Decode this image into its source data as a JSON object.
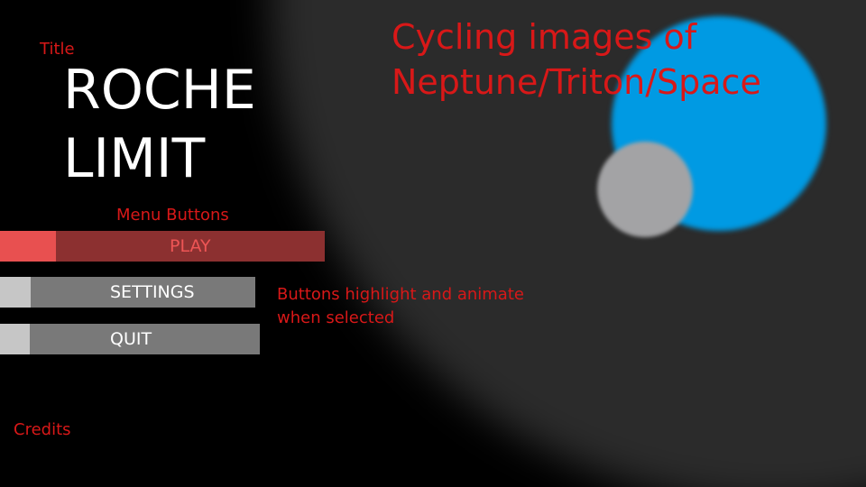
{
  "game_title": {
    "line1": "ROCHE",
    "line2": "LIMIT"
  },
  "menu": {
    "buttons": [
      {
        "label": "PLAY",
        "state": "selected"
      },
      {
        "label": "SETTINGS",
        "state": "normal"
      },
      {
        "label": "QUIT",
        "state": "normal"
      }
    ]
  },
  "annotations": {
    "title_note": "Title",
    "background_note_line1": "Cycling images of",
    "background_note_line2": "Neptune/Triton/Space",
    "menu_note": "Menu Buttons",
    "highlight_note_line1": "Buttons highlight and animate",
    "highlight_note_line2": "when selected",
    "credits_note": "Credits"
  },
  "colors": {
    "annotation": "#d81818",
    "planet": "#009ae3",
    "moon": "#a3a3a5",
    "selected_button_accent": "#e85050",
    "selected_button_body": "#8c3030",
    "button_body": "#797979",
    "button_accent": "#c6c6c6"
  }
}
